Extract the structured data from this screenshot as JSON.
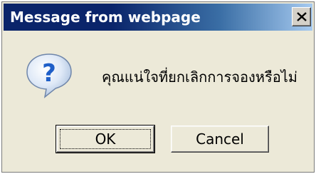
{
  "dialog": {
    "title": "Message from webpage",
    "message": "คุณแน่ใจที่ยกเลิกการจองหรือไม่",
    "icon": "question-icon",
    "buttons": {
      "ok_label": "OK",
      "cancel_label": "Cancel"
    },
    "close_glyph": "close-icon",
    "colors": {
      "titlebar_start": "#0a246a",
      "titlebar_end": "#a6caf0",
      "dialog_bg": "#ece9d8",
      "icon_blue": "#2a6fd6"
    }
  }
}
